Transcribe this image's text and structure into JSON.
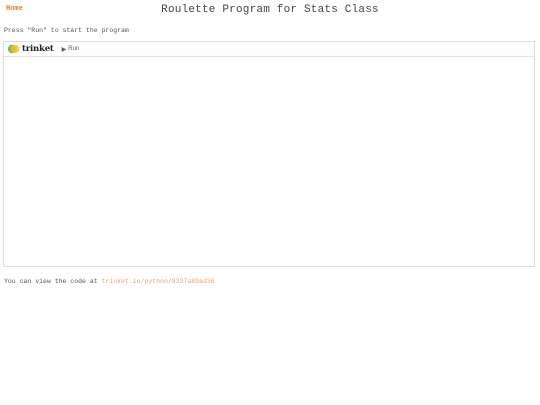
{
  "header": {
    "home_label": "Home",
    "title": "Roulette Program for Stats Class"
  },
  "instructions": "Press \"Run\" to start the program",
  "trinket": {
    "logo_text": "trinket",
    "run_label": "Run"
  },
  "footer": {
    "prefix": "You can view the code at",
    "link_text": "trinket.io/python/8337a89ad36"
  },
  "colors": {
    "home_link": "#e07b39",
    "code_link": "#e9a070",
    "logo_green": "#7ac143",
    "logo_yellow": "#f2c12e"
  }
}
